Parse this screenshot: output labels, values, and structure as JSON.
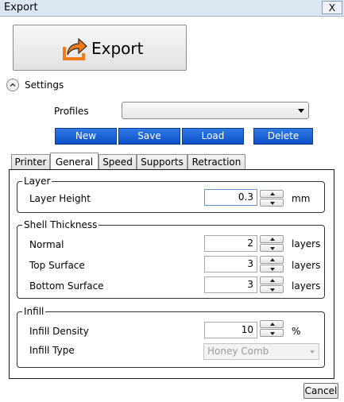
{
  "window": {
    "title": "Export",
    "close_glyph": "X"
  },
  "export_button": {
    "label": "Export",
    "icon": "export-arrow-icon",
    "icon_color": "#f07b16"
  },
  "settings": {
    "label": "Settings",
    "icon": "chevron-up-icon"
  },
  "profiles": {
    "label": "Profiles",
    "selected": ""
  },
  "profile_buttons": {
    "new": "New",
    "save": "Save",
    "load": "Load",
    "delete": "Delete",
    "color": "#0d4fc7"
  },
  "tabs": [
    {
      "label": "Printer",
      "active": false
    },
    {
      "label": "General",
      "active": true
    },
    {
      "label": "Speed",
      "active": false
    },
    {
      "label": "Supports",
      "active": false
    },
    {
      "label": "Retraction",
      "active": false
    }
  ],
  "layer": {
    "legend": "Layer",
    "height": {
      "label": "Layer Height",
      "value": "0.3",
      "unit": "mm"
    }
  },
  "shell": {
    "legend": "Shell Thickness",
    "normal": {
      "label": "Normal",
      "value": "2",
      "unit": "layers"
    },
    "top": {
      "label": "Top Surface",
      "value": "3",
      "unit": "layers"
    },
    "bottom": {
      "label": "Bottom Surface",
      "value": "3",
      "unit": "layers"
    }
  },
  "infill": {
    "legend": "Infill",
    "density": {
      "label": "Infill Density",
      "value": "10",
      "unit": "%"
    },
    "type": {
      "label": "Infill Type",
      "value": "Honey Comb"
    }
  },
  "footer": {
    "cancel": "Cancel"
  }
}
